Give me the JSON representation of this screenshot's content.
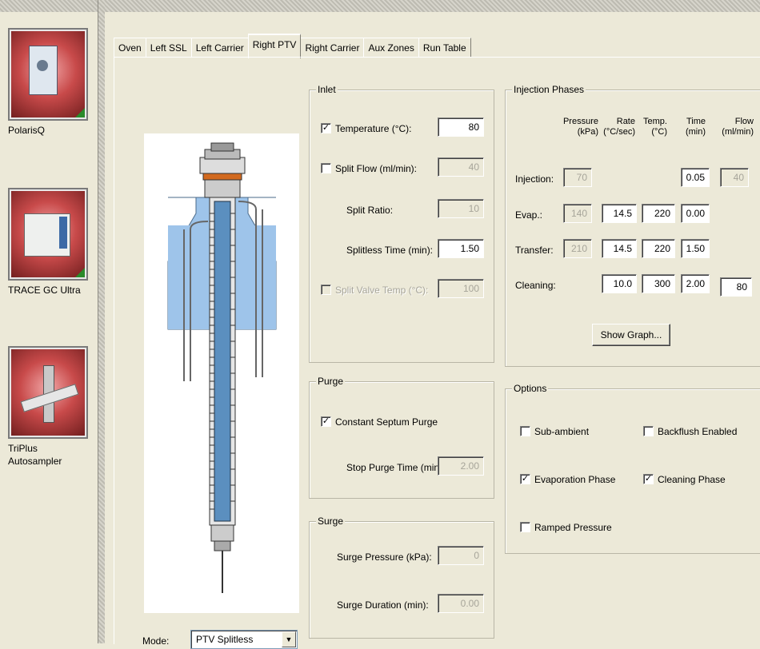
{
  "sidebar": {
    "devices": [
      {
        "label": "PolarisQ"
      },
      {
        "label": "TRACE GC Ultra"
      },
      {
        "label": "TriPlus\nAutosampler"
      }
    ]
  },
  "tabs": [
    "Oven",
    "Left SSL",
    "Left Carrier",
    "Right PTV",
    "Right Carrier",
    "Aux Zones",
    "Run Table"
  ],
  "active_tab": "Right PTV",
  "mode": {
    "label": "Mode:",
    "value": "PTV Splitless"
  },
  "inlet": {
    "title": "Inlet",
    "temperature": {
      "label": "Temperature (°C):",
      "value": "80",
      "checked": true
    },
    "split_flow": {
      "label": "Split Flow (ml/min):",
      "value": "40",
      "checked": false
    },
    "split_ratio": {
      "label": "Split Ratio:",
      "value": "10"
    },
    "splitless_time": {
      "label": "Splitless Time (min):",
      "value": "1.50"
    },
    "split_valve_temp": {
      "label": "Split Valve Temp (°C):",
      "value": "100",
      "checked": false
    }
  },
  "purge": {
    "title": "Purge",
    "constant_septum": {
      "label": "Constant Septum Purge",
      "checked": true
    },
    "stop_purge_time": {
      "label": "Stop Purge Time (min):",
      "value": "2.00"
    }
  },
  "surge": {
    "title": "Surge",
    "pressure": {
      "label": "Surge Pressure (kPa):",
      "value": "0"
    },
    "duration": {
      "label": "Surge Duration (min):",
      "value": "0.00"
    }
  },
  "phases": {
    "title": "Injection Phases",
    "headers": [
      {
        "l1": "Pressure",
        "l2": "(kPa)"
      },
      {
        "l1": "Rate",
        "l2": "(°C/sec)"
      },
      {
        "l1": "Temp.",
        "l2": "(°C)"
      },
      {
        "l1": "Time",
        "l2": "(min)"
      },
      {
        "l1": "Flow",
        "l2": "(ml/min)"
      }
    ],
    "rows": [
      {
        "label": "Injection:",
        "pressure": "70",
        "rate": "",
        "temp": "",
        "time": "0.05",
        "flow": "40"
      },
      {
        "label": "Evap.:",
        "pressure": "140",
        "rate": "14.5",
        "temp": "220",
        "time": "0.00",
        "flow": ""
      },
      {
        "label": "Transfer:",
        "pressure": "210",
        "rate": "14.5",
        "temp": "220",
        "time": "1.50",
        "flow": ""
      },
      {
        "label": "Cleaning:",
        "pressure": "",
        "rate": "10.0",
        "temp": "300",
        "time": "2.00",
        "flow": "80"
      }
    ],
    "show_graph": "Show Graph..."
  },
  "options": {
    "title": "Options",
    "subambient": {
      "label": "Sub-ambient",
      "checked": false
    },
    "backflush": {
      "label": "Backflush Enabled",
      "checked": false
    },
    "evaporation": {
      "label": "Evaporation Phase",
      "checked": true
    },
    "cleaning": {
      "label": "Cleaning Phase",
      "checked": true
    },
    "ramped": {
      "label": "Ramped Pressure",
      "checked": false
    }
  },
  "colors": {
    "oven_block": "#9ec4ea",
    "liner": "#5b8fbf"
  }
}
